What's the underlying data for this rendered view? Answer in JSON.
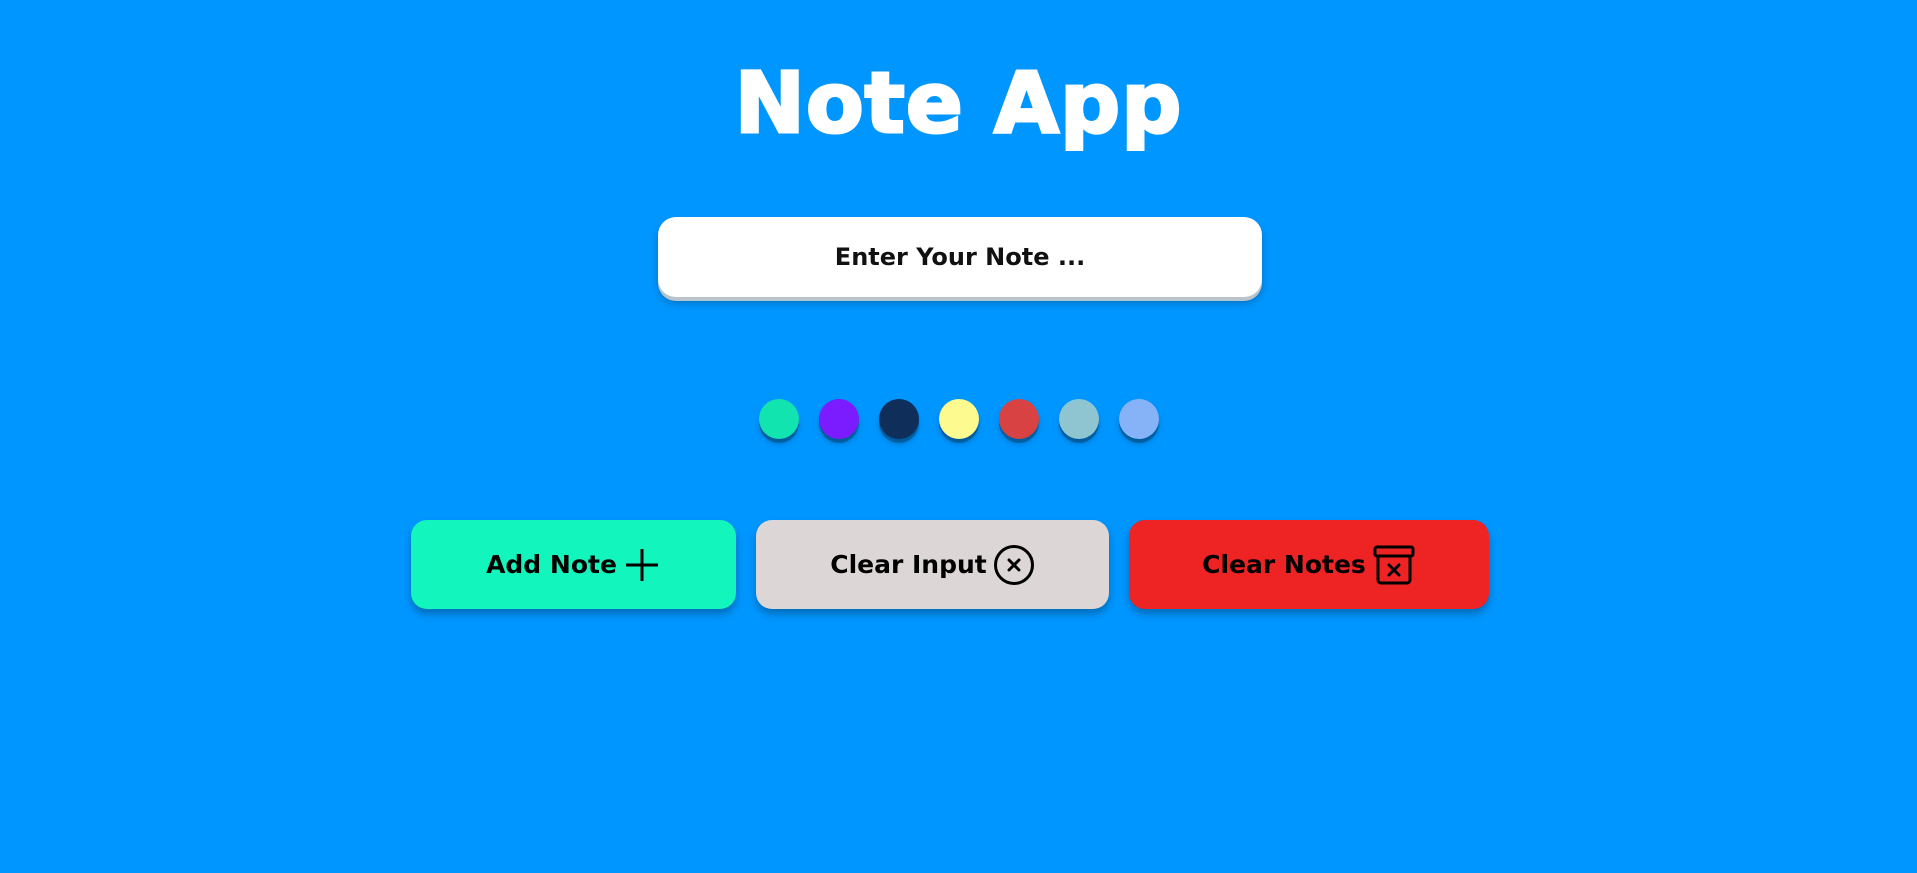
{
  "app": {
    "title": "Note App"
  },
  "note_input": {
    "placeholder": "Enter Your Note ...",
    "value": ""
  },
  "color_swatches": [
    {
      "name": "teal",
      "color": "#12e4b0"
    },
    {
      "name": "purple",
      "color": "#7a1cff"
    },
    {
      "name": "navy",
      "color": "#0f2f5a"
    },
    {
      "name": "yellow",
      "color": "#fdfa8f"
    },
    {
      "name": "red",
      "color": "#d94242"
    },
    {
      "name": "light-blue-gray",
      "color": "#8fc5d0"
    },
    {
      "name": "periwinkle",
      "color": "#86b3f7"
    }
  ],
  "buttons": {
    "add_note": {
      "label": "Add Note",
      "icon": "plus-icon",
      "color": "#12f5bd"
    },
    "clear_input": {
      "label": "Clear Input",
      "icon": "circle-x-icon",
      "color": "#dcd7d6"
    },
    "clear_notes": {
      "label": "Clear Notes",
      "icon": "archive-x-icon",
      "color": "#ee2324"
    }
  },
  "theme": {
    "background": "#0096ff",
    "title_color": "#ffffff"
  }
}
